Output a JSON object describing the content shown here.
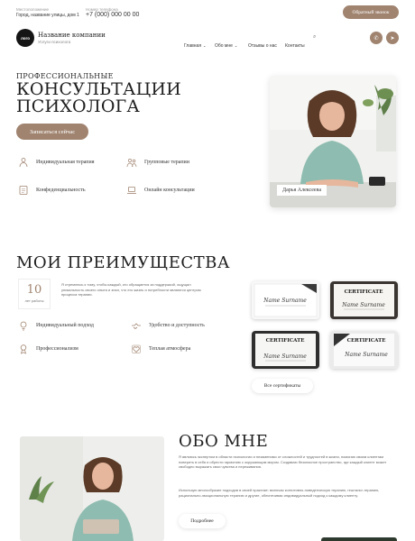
{
  "topbar": {
    "location_label": "Местоположение",
    "address": "Город, название улицы, дом 1",
    "phone_label": "Номер телефона",
    "phone": "+7 (000) 000 00 00",
    "callback_button": "Обратный звонок"
  },
  "header": {
    "logo": "лого",
    "company_name": "Название компании",
    "company_sub": "Услуги психолога",
    "nav": [
      "Главная",
      "Обо мне",
      "Отзывы о нас",
      "Контакты"
    ]
  },
  "hero": {
    "kicker": "ПРОФЕССИОНАЛЬНЫЕ",
    "title_line1": "КОНСУЛЬТАЦИИ",
    "title_line2": "ПСИХОЛОГА",
    "cta": "Записаться сейчас",
    "services": [
      "Индивидуальная терапия",
      "Групповые терапии",
      "Конфеденциальность",
      "Онлайн консультации"
    ],
    "photo_caption": "Дарья Алексеева"
  },
  "advantages": {
    "title": "МОИ ПРЕИМУЩЕСТВА",
    "years_num": "10",
    "years_label": "лет работы",
    "text": "Я стремлюсь к тому, чтобы каждый, кто обращается за поддержкой, ощущал уникальность своего опыта и знал, что его жизнь и потребности являются центром процесса терапии.",
    "items": [
      "Индивидуальный подход",
      "Удобство и доступность",
      "Профессионализм",
      "Теплая атмосфера"
    ],
    "certificates_button": "Все сертификаты",
    "cert_title": "CERTIFICATE",
    "cert_name": "Name Surname"
  },
  "about": {
    "title": "ОБО МНЕ",
    "para1": "Я являюсь экспертом в области психологии и незаменимо от сложностей и трудностей в жизни, помогаю своим клиентам поверить в себя и обрести гармонию с окружающим миром. Создаваю безопасное пространство, где каждый клиент может свободно выражать свои чувства и переживания.",
    "para2": "Использую многообразие подходов в своей практике: включая когнитивно-поведенческую терапию, гештальт-терапию, рационально-эмоциональную терапию и другие, обеспечивая индивидуальный подход к каждому клиенту.",
    "more_button": "Подробнее"
  },
  "colors": {
    "accent": "#a08470",
    "dark": "#151515"
  }
}
